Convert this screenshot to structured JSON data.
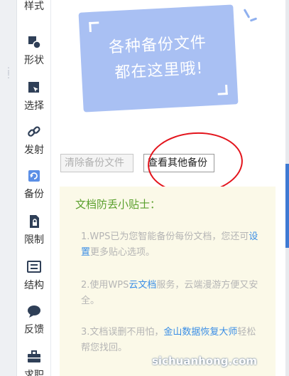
{
  "sidebar": {
    "items": [
      {
        "label": "样式",
        "icon": "style-icon"
      },
      {
        "label": "形状",
        "icon": "shape-icon"
      },
      {
        "label": "选择",
        "icon": "select-icon"
      },
      {
        "label": "发射",
        "icon": "link-icon"
      },
      {
        "label": "备份",
        "icon": "backup-icon",
        "active": true
      },
      {
        "label": "限制",
        "icon": "restrict-icon"
      },
      {
        "label": "结构",
        "icon": "structure-icon"
      },
      {
        "label": "反馈",
        "icon": "feedback-icon"
      },
      {
        "label": "求职",
        "icon": "job-icon"
      }
    ]
  },
  "card": {
    "line1": "各种备份文件",
    "line2": "都在这里哦!"
  },
  "buttons": {
    "clear_label": "清除备份文件",
    "other_label": "查看其他备份"
  },
  "tips": {
    "title": "文档防丢小贴士：",
    "tip1_a": "1.WPS已为您智能备份每份文档，您还可",
    "tip1_link": "设置",
    "tip1_b": "更多贴心选项。",
    "tip2_a": "2.使用WPS",
    "tip2_link": "云文档",
    "tip2_b": "服务，云端漫游方便又安全。",
    "tip3_a": "3.文档误删不用怕，",
    "tip3_link": "金山数据恢复大师",
    "tip3_b": "轻松帮您找回。"
  },
  "watermark": "sichuanhong.com",
  "colors": {
    "accent_blue": "#3f7ad3",
    "card_blue": "#a9c0f3",
    "tips_title_green": "#5aa02c",
    "link_blue": "#3a8ee6",
    "annotation_red": "#e3141c",
    "tips_bg": "#fbf9e8"
  }
}
